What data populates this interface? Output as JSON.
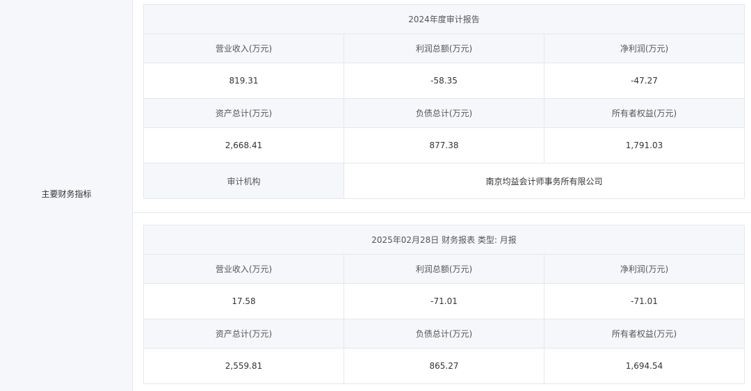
{
  "left": {
    "label": "主要财务指标"
  },
  "report_2024": {
    "title": "2024年度审计报告",
    "row1_headers": [
      "营业收入(万元)",
      "利润总额(万元)",
      "净利润(万元)"
    ],
    "row1_values": [
      "819.31",
      "-58.35",
      "-47.27"
    ],
    "row2_headers": [
      "资产总计(万元)",
      "负债总计(万元)",
      "所有者权益(万元)"
    ],
    "row2_values": [
      "2,668.41",
      "877.38",
      "1,791.03"
    ],
    "auditor_label": "审计机构",
    "auditor_value": "南京均益会计师事务所有限公司"
  },
  "report_2025": {
    "title": "2025年02月28日 财务报表 类型: 月报",
    "row1_headers": [
      "营业收入(万元)",
      "利润总额(万元)",
      "净利润(万元)"
    ],
    "row1_values": [
      "17.58",
      "-71.01",
      "-71.01"
    ],
    "row2_headers": [
      "资产总计(万元)",
      "负债总计(万元)",
      "所有者权益(万元)"
    ],
    "row2_values": [
      "2,559.81",
      "865.27",
      "1,694.54"
    ]
  }
}
